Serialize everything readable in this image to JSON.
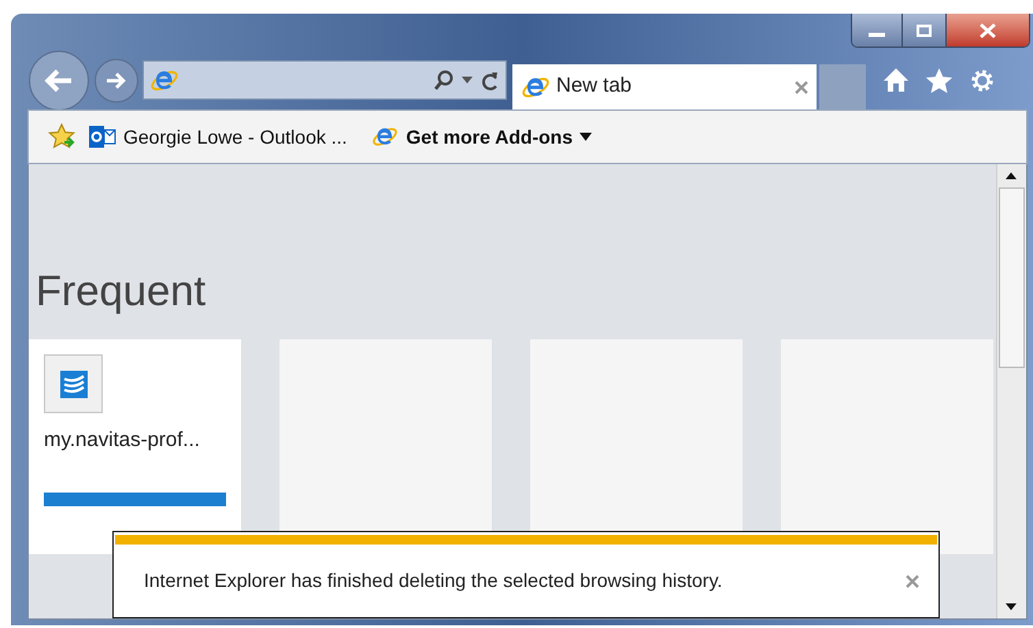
{
  "tabs": [
    {
      "label": "New tab",
      "selected": true
    }
  ],
  "favorites_bar": {
    "items": [
      {
        "label": "Georgie Lowe - Outlook ...",
        "kind": "outlook",
        "bold": false,
        "dropdown": false
      },
      {
        "label": "Get more Add-ons",
        "kind": "ie",
        "bold": true,
        "dropdown": true
      }
    ]
  },
  "page": {
    "heading": "Frequent",
    "tiles": [
      {
        "kind": "site",
        "label": "my.navitas-prof..."
      },
      {
        "kind": "empty"
      },
      {
        "kind": "empty"
      },
      {
        "kind": "empty"
      }
    ]
  },
  "notification": {
    "message": "Internet Explorer has finished deleting the selected browsing history."
  }
}
